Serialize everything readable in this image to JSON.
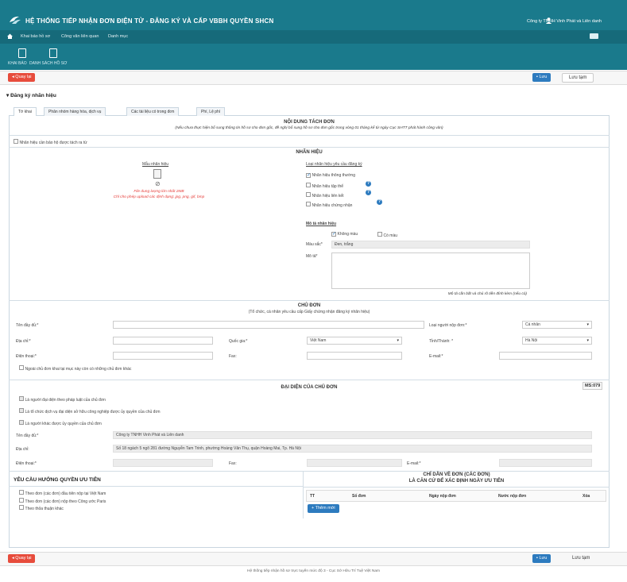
{
  "header": {
    "title": "HỆ THỐNG TIẾP NHẬN ĐƠN ĐIỆN TỬ - ĐĂNG KÝ VÀ CẤP VBBH QUYỀN SHCN",
    "user": "Công ty TNHH Vinh Phát và Liên danh"
  },
  "menu": [
    "Khai báo hồ sơ",
    "Công văn liên quan",
    "Danh mục"
  ],
  "subnav": [
    "KHAI BÁO",
    "DANH SÁCH HỒ SƠ"
  ],
  "toolbar": {
    "back": "Quay lại",
    "save": "Lưu",
    "draft": "Lưu tạm"
  },
  "section_heading": "Đăng ký nhãn hiệu",
  "tabs": [
    "Tờ khai",
    "Phân nhóm hàng hóa, dịch vụ",
    "Các tài liệu có trong đơn",
    "Phí, Lệ phí"
  ],
  "split": {
    "title": "NỘI DUNG TÁCH ĐƠN",
    "note": "(Nếu chưa thực hiện bổ sung thông tin hồ sơ cho đơn gốc, đề nghị bổ sung hồ sơ cho đơn gốc trong vòng 01 tháng kể từ ngày Cục SHTT phát hành công văn)",
    "checkbox": "Nhãn hiệu cần bảo hộ được tách ra từ"
  },
  "mark": {
    "title": "NHÃN HIỆU",
    "sample_label": "Mẫu nhãn hiệu",
    "upload_note_1": "File dung lượng lớn nhất 2MB",
    "upload_note_2": "Chỉ cho phép upload các định dạng: jpg, png, gif, bmp",
    "type_label": "Loại nhãn hiệu yêu cầu đăng ký",
    "types": [
      "Nhãn hiệu thông thường",
      "Nhãn hiệu tập thể",
      "Nhãn hiệu liên kết",
      "Nhãn hiệu chứng nhận"
    ],
    "desc_title": "Mô tả nhãn hiệu",
    "color_none": "Không màu",
    "color_has": "Có màu",
    "color_label": "Màu sắc*",
    "color_value": "Đen, trắng",
    "desc_label": "Mô tả*",
    "desc_note": "Mô tả cần bắt và chú rõ tiền đính kèm (nếu có)"
  },
  "applicant": {
    "title": "CHỦ ĐƠN",
    "subtitle": "(Tổ chức, cá nhân yêu cầu cấp Giấy chứng nhận đăng ký nhãn hiệu)",
    "name_label": "Tên đầy đủ:*",
    "type_label": "Loại người nộp đơn:*",
    "type_value": "Cá nhân",
    "address_label": "Địa chỉ:*",
    "country_label": "Quốc gia:*",
    "country_value": "Việt Nam",
    "province_label": "Tỉnh/Thành: *",
    "province_value": "Hà Nội",
    "phone_label": "Điện thoại:*",
    "fax_label": "Fax:",
    "email_label": "E-mail:*",
    "other_checkbox": "Ngoài chủ đơn khai tại mục này còn có những chủ đơn khác"
  },
  "representative": {
    "title": "ĐẠI DIỆN CỦA CHỦ ĐƠN",
    "code": "MS:079",
    "options": [
      "Là người đại diện theo pháp luật của chủ đơn",
      "Là tổ chức dịch vụ đại diện sở hữu công nghiệp được ủy quyền của chủ đơn",
      "Là người khác được ủy quyền của chủ đơn"
    ],
    "name_label": "Tên đầy đủ:*",
    "name_value": "Công ty TNHH Vinh Phát và Liên danh",
    "address_label": "Địa chỉ:",
    "address_value": "Số 18 ngách 5 ngõ 281 đường Nguyễn Tam Trinh, phường Hoàng Văn Thụ, quận Hoàng Mai, Tp. Hà Nội",
    "phone_label": "Điện thoại:*",
    "fax_label": "Fax:",
    "email_label": "E-mail:*"
  },
  "priority": {
    "title": "YÊU CẦU HƯỞNG QUYỀN ƯU TIÊN",
    "options": [
      "Theo đơn (các đơn) đầu tiên nộp tại Việt Nam",
      "Theo đơn (các đơn) nộp theo Công ước Paris",
      "Theo thỏa thuận khác"
    ]
  },
  "reference": {
    "title_1": "CHỈ DẪN VỀ ĐƠN (CÁC ĐƠN)",
    "title_2": "LÀ CĂN CỨ ĐỂ XÁC ĐỊNH NGÀY ƯU TIÊN",
    "columns": [
      "TT",
      "Số đơn",
      "Ngày nộp đơn",
      "Nước nộp đơn",
      "Xóa"
    ],
    "add_button": "Thêm mới"
  },
  "footer": "Hệ thống tiếp nhận hồ sơ trực tuyến mức độ 3 - Cục Sở Hữu Trí Tuệ Việt Nam"
}
